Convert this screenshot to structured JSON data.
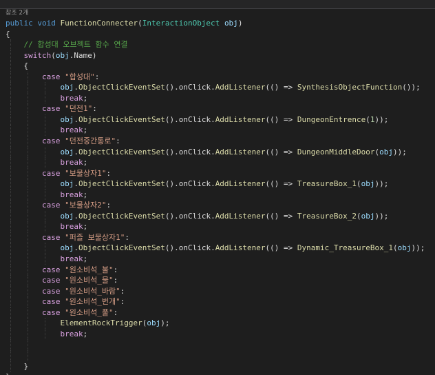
{
  "editor": {
    "references_label": "참조 2개",
    "signature": {
      "access": "public",
      "return_type": "void",
      "method_name": "FunctionConnecter",
      "param_type": "InteractionObject",
      "param_name": "obj"
    },
    "comment": "// 합성대 오브젝트 함수 연결",
    "switch_keyword": "switch",
    "switch_target_obj": "obj",
    "switch_target_member": "Name",
    "case_keyword": "case",
    "break_keyword": "break",
    "call_chain": {
      "receiver": "obj",
      "method1": "ObjectClickEventSet",
      "field": "onClick",
      "method2": "AddListener",
      "arrow": "() =>"
    },
    "cases": [
      {
        "label": "\"합성대\"",
        "call": "SynthesisObjectFunction",
        "arg": "",
        "arg_kind": "none"
      },
      {
        "label": "\"던전1\"",
        "call": "DungeonEntrence",
        "arg": "1",
        "arg_kind": "number"
      },
      {
        "label": "\"던전중간통로\"",
        "call": "DungeonMiddleDoor",
        "arg": "obj",
        "arg_kind": "param"
      },
      {
        "label": "\"보물상자1\"",
        "call": "TreasureBox_1",
        "arg": "obj",
        "arg_kind": "param"
      },
      {
        "label": "\"보물상자2\"",
        "call": "TreasureBox_2",
        "arg": "obj",
        "arg_kind": "param"
      },
      {
        "label": "\"퍼즐 보물상자1\"",
        "call": "Dynamic_TreasureBox_1",
        "arg": "obj",
        "arg_kind": "param"
      }
    ],
    "element_cases": [
      "\"원소비석_불\"",
      "\"원소비석_물\"",
      "\"원소비석_바람\"",
      "\"원소비석_번개\"",
      "\"원소비석_풀\""
    ],
    "element_call": "ElementRockTrigger",
    "element_call_arg": "obj"
  }
}
